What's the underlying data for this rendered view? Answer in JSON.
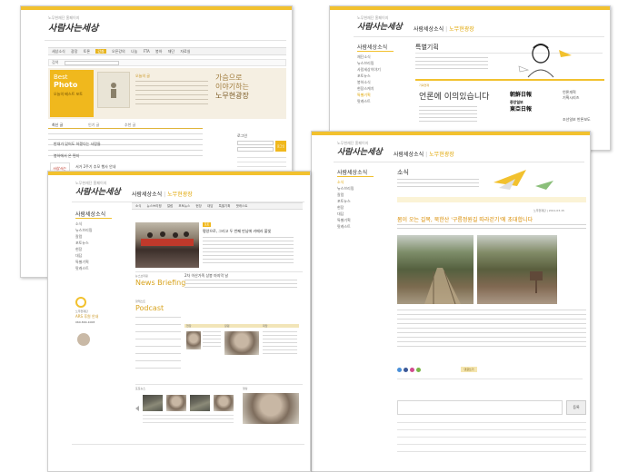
{
  "site": {
    "logo": "사람사는세상",
    "tagline": "노무현재단 홈페이지",
    "nav": [
      "사람세상소식",
      "노무현광장"
    ]
  },
  "win1": {
    "menu": [
      "세상소식",
      "광장",
      "토론",
      "강좌",
      "오픈강의",
      "나눔",
      "FTA",
      "봉하",
      "재단",
      "자료실"
    ],
    "menu_active_index": 3,
    "search_label": "검색",
    "photo_badge": [
      "Best",
      "Photo"
    ],
    "photo_caption": "오늘의 베스트 포토",
    "feature_label": "오늘의 글",
    "feature_quote": [
      "가슴으로",
      "이야기하는",
      "노무현광장"
    ],
    "tabs": [
      "최신 글",
      "인기 글",
      "추천 글"
    ],
    "list": [
      "반대가 있어도 하겠다는 사람들",
      "봉하에서 온 편지",
      "서거 2주기 추모 행사 안내"
    ],
    "side_label": "로그인",
    "login_button": "로그인",
    "thumb_logo": "사람사는세상"
  },
  "win2": {
    "sidenav_title": "사람세상소식",
    "sidenav": [
      "재단소식",
      "뉴스브리핑",
      "사람세상이야기",
      "포토뉴스",
      "봉하소식",
      "현장스케치",
      "특별기획",
      "팟캐스트"
    ],
    "sidenav_active_index": 6,
    "section_title": "특별기획",
    "headline": "언론에 이의있습니다",
    "papers": [
      "朝鮮日報",
      "東亞日報",
      "중앙일보",
      "조선일보"
    ],
    "right_labels": [
      "언론개혁",
      "기획시리즈"
    ],
    "footer_label": "조선일보 반론보도",
    "badge": "기획연재"
  },
  "win3": {
    "sidenav_title": "사람세상소식",
    "sidenav": [
      "소식",
      "뉴스브리핑",
      "칼럼",
      "포토뉴스",
      "현장",
      "대담",
      "특별기획",
      "팟캐스트"
    ],
    "sidenav_active_index": 0,
    "section_title": "소식",
    "headline": "봄이 오는 길목, 북한산 '구름정원길 따라걷기'에 초대합니다",
    "byline": "노무현재단 | 2011.03.15",
    "comment_button": "댓글쓰기",
    "submit_button": "등록"
  },
  "win4": {
    "sidenav_title": "사람세상소식",
    "sidenav": [
      "소식",
      "뉴스브리핑",
      "칼럼",
      "포토뉴스",
      "현장",
      "대담",
      "특별기획",
      "팟캐스트"
    ],
    "menu": [
      "소식",
      "뉴스브리핑",
      "칼럼",
      "포토뉴스",
      "현장",
      "대담",
      "특별기획",
      "팟캐스트"
    ],
    "lead_tag": "포토",
    "lead_title": "평양으로, 그리고 두 번째 만남에 카메라 불빛",
    "news_label": "뉴스브리핑",
    "news_title": "News Briefing",
    "news_headline": "2차 이산가족 상봉 마지막 날",
    "podcast_label": "팟캐스트",
    "podcast_title": "Podcast",
    "promo": [
      "노무현재단",
      "ARS 후원 안내",
      "060-800-1008"
    ],
    "mini_labels": [
      "현장",
      "칼럼",
      "대담"
    ],
    "bottom_labels": [
      "포토뉴스",
      "영상"
    ]
  }
}
